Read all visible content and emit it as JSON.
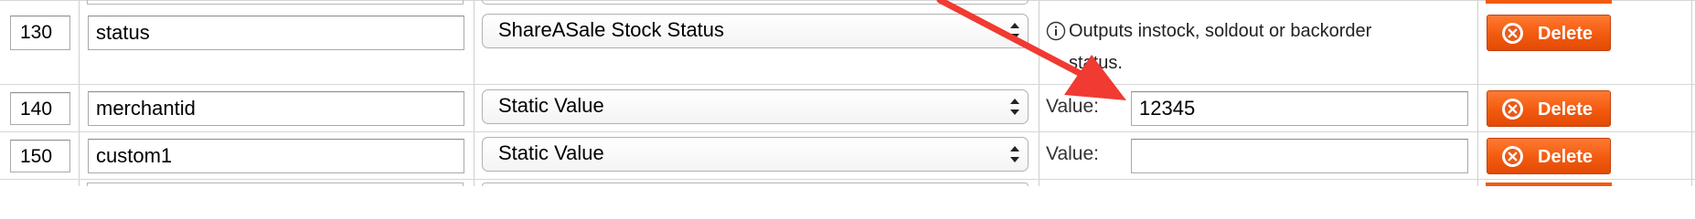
{
  "rows": [
    {
      "sort": "130",
      "name": "status",
      "type": "ShareASale Stock Status",
      "info": {
        "icon": "info-circle-icon",
        "line1": "Outputs instock, soldout or backorder",
        "line2": "status."
      },
      "delete_label": "Delete"
    },
    {
      "sort": "140",
      "name": "merchantid",
      "type": "Static Value",
      "value_label": "Value:",
      "value": "12345",
      "delete_label": "Delete"
    },
    {
      "sort": "150",
      "name": "custom1",
      "type": "Static Value",
      "value_label": "Value:",
      "value": "",
      "delete_label": "Delete"
    }
  ],
  "annotation": {
    "icon": "red-arrow-icon",
    "color": "#f03a32"
  },
  "colors": {
    "delete_button": "#f25a0f",
    "grid_line": "#cfcfcf"
  }
}
